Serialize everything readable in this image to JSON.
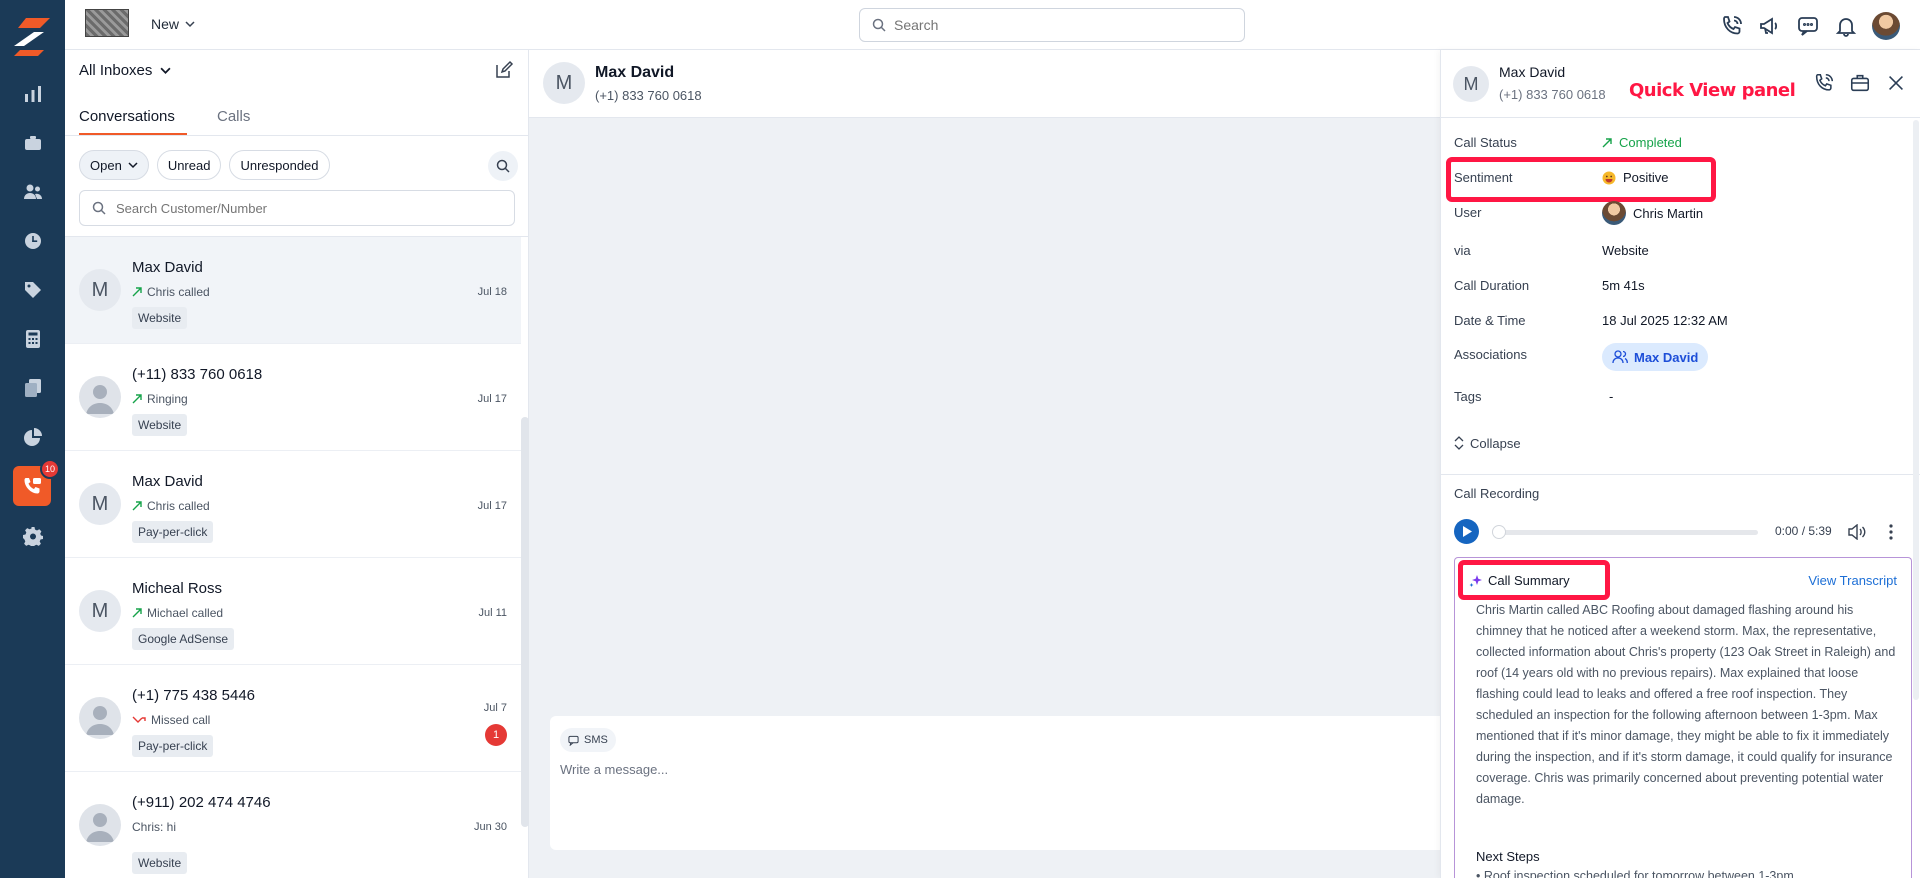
{
  "topbar": {
    "new_label": "New",
    "search_placeholder": "Search",
    "icons": [
      "phone-icon",
      "megaphone-icon",
      "chat-icon",
      "bell-icon"
    ]
  },
  "rail": {
    "items": [
      "dashboard-icon",
      "briefcase-icon",
      "users-icon",
      "clock-icon",
      "tag-icon",
      "calculator-icon",
      "files-icon",
      "pie-chart-icon",
      "phone-chat-icon",
      "gear-icon"
    ],
    "badge": "10",
    "accent": "#f05a28"
  },
  "list": {
    "inbox_label": "All Inboxes",
    "tabs": [
      "Conversations",
      "Calls"
    ],
    "filters": [
      "Open",
      "Unread",
      "Unresponded"
    ],
    "search_placeholder": "Search Customer/Number",
    "items": [
      {
        "initial": "M",
        "name": "Max David",
        "status": "Chris called",
        "tag": "Website",
        "date": "Jul 18"
      },
      {
        "initial": "",
        "name": "(+11) 833 760 0618",
        "status": "Ringing",
        "tag": "Website",
        "date": "Jul 17"
      },
      {
        "initial": "M",
        "name": "Max David",
        "status": "Chris called",
        "tag": "Pay-per-click",
        "date": "Jul 17"
      },
      {
        "initial": "M",
        "name": "Micheal Ross",
        "status": "Michael called",
        "tag": "Google AdSense",
        "date": "Jul 11"
      },
      {
        "initial": "",
        "name": "(+1) 775 438 5446",
        "status": "Missed call",
        "tag": "Pay-per-click",
        "date": "Jul 7",
        "unread": "1"
      },
      {
        "initial": "",
        "name": "(+911) 202 474 4746",
        "status": "Chris: hi",
        "tag": "Website",
        "date": "Jun 30"
      }
    ]
  },
  "chat": {
    "initial": "M",
    "name": "Max David",
    "phone": "(+1) 833 760 0618",
    "channel": "SMS",
    "message_placeholder": "Write a message..."
  },
  "quickview": {
    "initial": "M",
    "name": "Max David",
    "phone": "(+1) 833 760 0618",
    "annotation": "Quick View panel",
    "fields": {
      "call_status_k": "Call Status",
      "call_status_v": "Completed",
      "sentiment_k": "Sentiment",
      "sentiment_v": "Positive",
      "user_k": "User",
      "user_v": "Chris Martin",
      "via_k": "via",
      "via_v": "Website",
      "duration_k": "Call Duration",
      "duration_v": "5m 41s",
      "datetime_k": "Date & Time",
      "datetime_v": "18 Jul 2025 12:32 AM",
      "assoc_k": "Associations",
      "assoc_v": "Max David",
      "tags_k": "Tags",
      "tags_v": "-"
    },
    "collapse_label": "Collapse",
    "recording_label": "Call Recording",
    "time": "0:00 / 5:39",
    "summary_title": "Call Summary",
    "view_transcript": "View Transcript",
    "summary_text": "Chris Martin called ABC Roofing about damaged flashing around his chimney that he noticed after a weekend storm. Max, the representative, collected information about Chris's property (123 Oak Street in Raleigh) and roof (14 years old with no previous repairs). Max explained that loose flashing could lead to leaks and offered a free roof inspection. They scheduled an inspection for the following afternoon between 1-3pm. Max mentioned that if it's minor damage, they might be able to fix it immediately during the inspection, and if it's storm damage, it could qualify for insurance coverage. Chris was primarily concerned about preventing potential water damage.",
    "next_steps": "Next Steps",
    "next_step_1": "Roof inspection scheduled for tomorrow between 1-3pm"
  }
}
